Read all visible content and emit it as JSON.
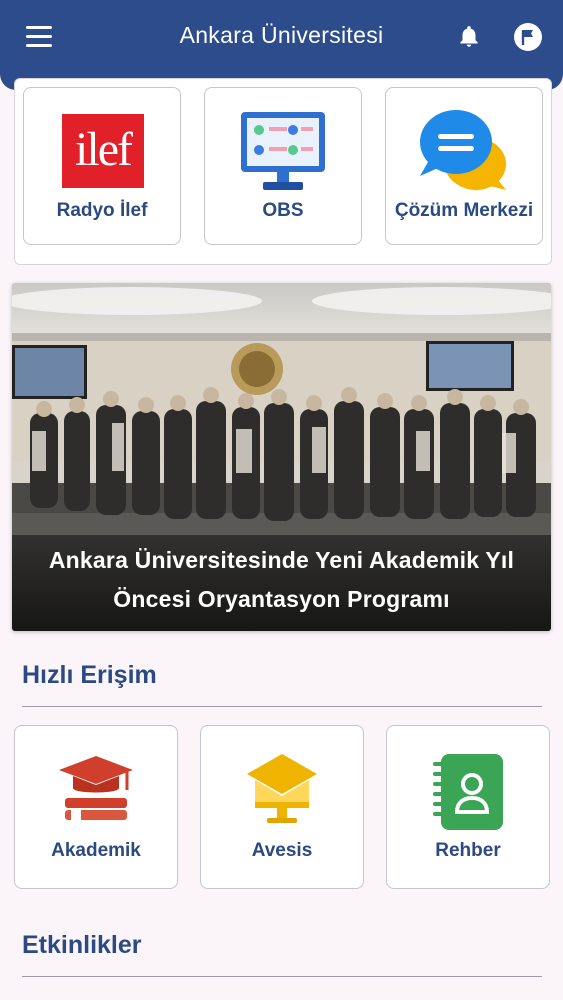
{
  "header": {
    "title": "Ankara Üniversitesi",
    "menu_icon": "hamburger-menu-icon",
    "notification_icon": "bell-icon",
    "language_icon": "flag-icon",
    "background_color": "#2c4c8c"
  },
  "top_tiles": [
    {
      "label": "Radyo İlef",
      "icon": "ilef-logo-icon",
      "logo_text": "ilef"
    },
    {
      "label": "OBS",
      "icon": "monitor-dashboard-icon"
    },
    {
      "label": "Çözüm Merkezi",
      "icon": "chat-bubbles-icon"
    }
  ],
  "news": {
    "headline": "Ankara Üniversitesinde Yeni Akademik Yıl Öncesi Oryantasyon Programı",
    "image": "group-photo-conference-room"
  },
  "quick_access": {
    "title": "Hızlı Erişim",
    "tiles": [
      {
        "label": "Akademik",
        "icon": "graduation-cap-books-icon"
      },
      {
        "label": "Avesis",
        "icon": "cap-monitor-icon"
      },
      {
        "label": "Rehber",
        "icon": "contact-notebook-icon"
      }
    ]
  },
  "events": {
    "title": "Etkinlikler"
  },
  "colors": {
    "accent": "#2b4a82",
    "ilef_red": "#e2202a",
    "akademik_red": "#cf3f2b",
    "avesis_yellow": "#f0b300",
    "rehber_green": "#3aa655"
  }
}
